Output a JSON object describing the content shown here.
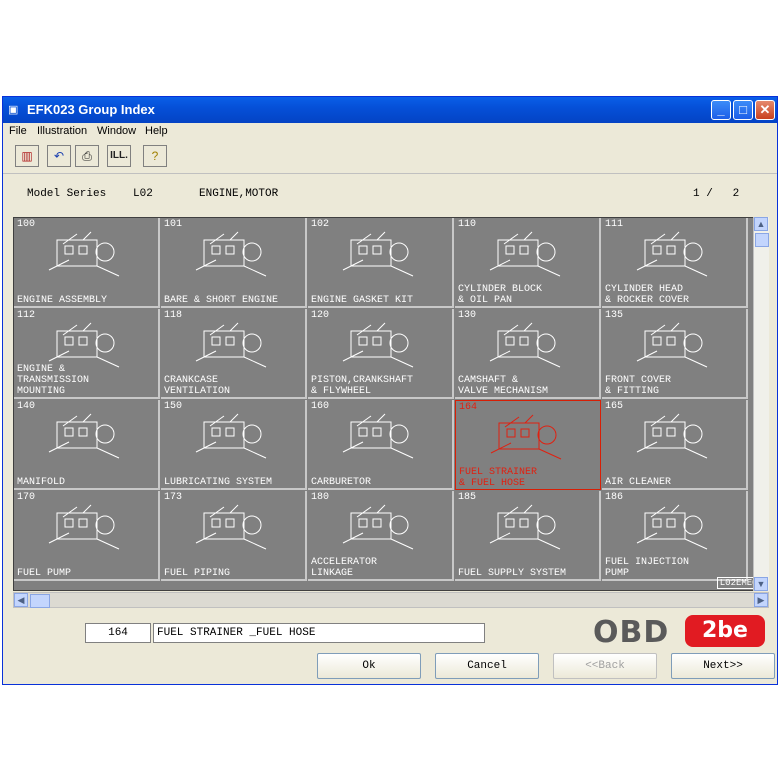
{
  "window": {
    "title": "EFK023 Group Index",
    "minimize": "_",
    "maximize": "□",
    "close": "✕"
  },
  "menu": [
    "File",
    "Illustration",
    "Window",
    "Help"
  ],
  "toolbar": {
    "icons": [
      "catalog-icon",
      "undo-icon",
      "print-icon",
      "illustration-icon",
      "help-icon"
    ],
    "ill_label": "ILL."
  },
  "model": {
    "label": "Model Series",
    "series": "L02",
    "group": "ENGINE,MOTOR",
    "page": "1 /   2"
  },
  "groups": [
    {
      "num": "100",
      "label": "ENGINE ASSEMBLY"
    },
    {
      "num": "101",
      "label": "BARE & SHORT ENGINE"
    },
    {
      "num": "102",
      "label": "ENGINE GASKET KIT"
    },
    {
      "num": "110",
      "label": "CYLINDER BLOCK\n& OIL PAN"
    },
    {
      "num": "111",
      "label": "CYLINDER HEAD\n& ROCKER COVER"
    },
    {
      "num": "112",
      "label": "ENGINE &\nTRANSMISSION\nMOUNTING"
    },
    {
      "num": "118",
      "label": "CRANKCASE\nVENTILATION"
    },
    {
      "num": "120",
      "label": "PISTON,CRANKSHAFT\n& FLYWHEEL"
    },
    {
      "num": "130",
      "label": "CAMSHAFT &\nVALVE MECHANISM"
    },
    {
      "num": "135",
      "label": "FRONT COVER\n& FITTING"
    },
    {
      "num": "140",
      "label": "MANIFOLD"
    },
    {
      "num": "150",
      "label": "LUBRICATING SYSTEM"
    },
    {
      "num": "160",
      "label": "CARBURETOR"
    },
    {
      "num": "164",
      "label": "FUEL STRAINER\n& FUEL HOSE",
      "selected": true
    },
    {
      "num": "165",
      "label": "AIR CLEANER"
    },
    {
      "num": "170",
      "label": "FUEL PUMP"
    },
    {
      "num": "173",
      "label": "FUEL PIPING"
    },
    {
      "num": "180",
      "label": "ACCELERATOR\nLINKAGE"
    },
    {
      "num": "185",
      "label": "FUEL SUPPLY SYSTEM"
    },
    {
      "num": "186",
      "label": "FUEL INJECTION\nPUMP"
    }
  ],
  "watermark": "L02EMEQA",
  "status": {
    "num": "164",
    "desc": "FUEL STRAINER _FUEL HOSE"
  },
  "buttons": {
    "ok": "Ok",
    "cancel": "Cancel",
    "back": "<<Back",
    "next": "Next>>"
  },
  "logo": {
    "left": "OBD",
    "right": "2be"
  }
}
